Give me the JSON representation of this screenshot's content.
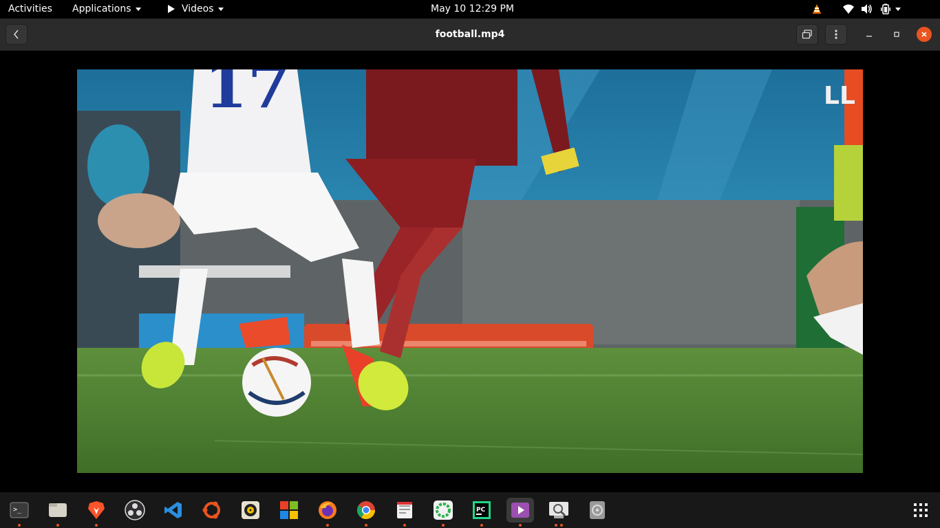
{
  "topbar": {
    "activities": "Activities",
    "applications": "Applications",
    "videos": "Videos",
    "clock": "May 10  12:29 PM"
  },
  "titlebar": {
    "title": "football.mp4"
  },
  "video": {
    "jersey_number": "17",
    "watermark": "LL"
  },
  "dock": {
    "apps": [
      "terminal-icon",
      "files-icon",
      "brave-icon",
      "obs-icon",
      "vscode-icon",
      "ubuntu-software-icon",
      "rhythmbox-icon",
      "windows-icon",
      "firefox-icon",
      "chrome-icon",
      "text-editor-icon",
      "tomboy-icon",
      "pycharm-icon",
      "videos-icon",
      "image-viewer-icon",
      "disks-icon",
      "show-applications-icon"
    ]
  },
  "colors": {
    "accent": "#e95420",
    "close": "#e95420",
    "pitch": "#4a7a30"
  }
}
